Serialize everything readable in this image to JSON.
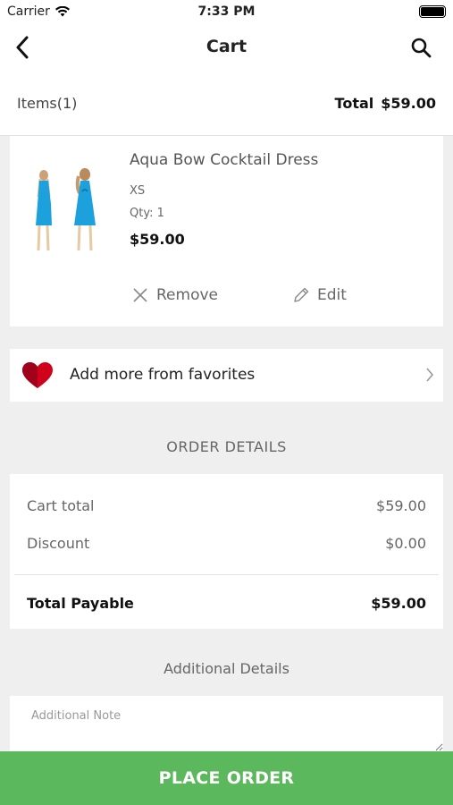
{
  "status_bar": {
    "carrier": "Carrier",
    "time": "7:33 PM"
  },
  "nav": {
    "title": "Cart",
    "back_icon": "chevron-left-icon",
    "search_icon": "search-icon"
  },
  "summary": {
    "items_label": "Items(1)",
    "total_label": "Total",
    "total_value": "$59.00"
  },
  "cart_items": [
    {
      "name": "Aqua Bow Cocktail Dress",
      "size": "XS",
      "qty": "Qty: 1",
      "price": "$59.00",
      "remove_label": "Remove",
      "edit_label": "Edit"
    }
  ],
  "favorites": {
    "label": "Add more from favorites",
    "icon": "heart-icon"
  },
  "order_details": {
    "title": "ORDER DETAILS",
    "cart_total_label": "Cart total",
    "cart_total_value": "$59.00",
    "discount_label": "Discount",
    "discount_value": "$0.00",
    "payable_label": "Total Payable",
    "payable_value": "$59.00"
  },
  "additional": {
    "title": "Additional Details",
    "note_placeholder": "Additional Note"
  },
  "place_order": {
    "label": "PLACE ORDER"
  },
  "colors": {
    "accent": "#5cb85c",
    "heart": "#d0021b",
    "dress": "#1da1dc"
  }
}
